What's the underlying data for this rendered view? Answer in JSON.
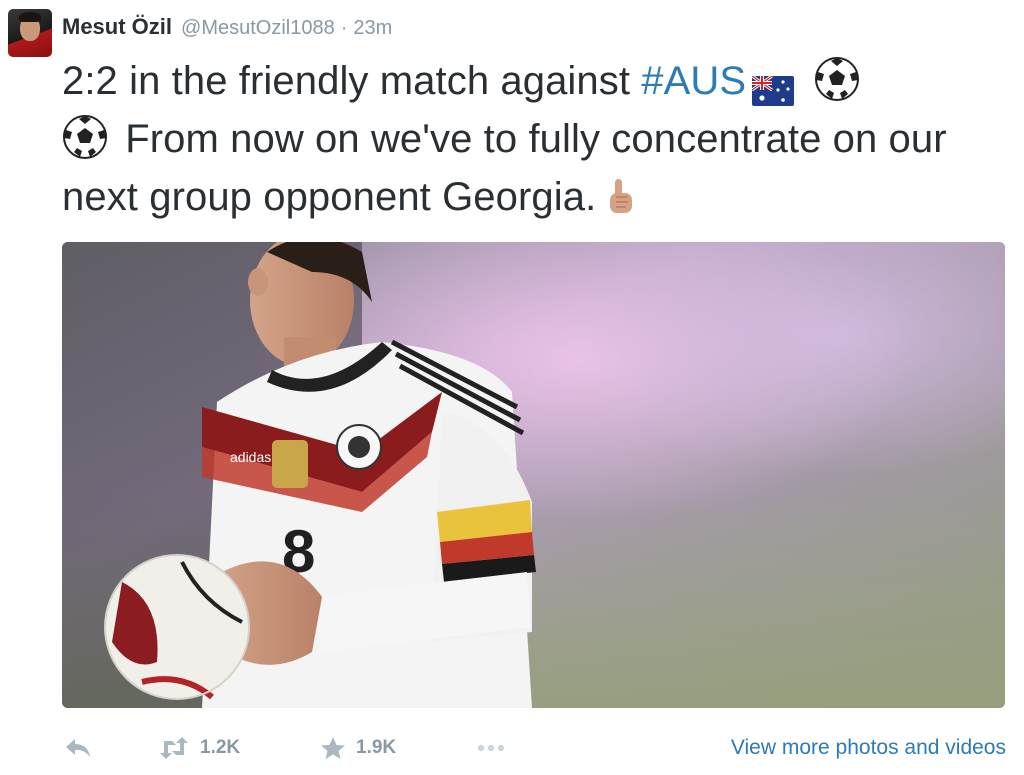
{
  "author": {
    "fullname": "Mesut Özil",
    "username": "@MesutOzil1088",
    "separator": "·",
    "timestamp": "23m"
  },
  "tweet": {
    "text_part1": "2:2 in the friendly match against ",
    "hashtag": "#AUS",
    "text_part2": "From now on we've to fully concentrate on our next group opponent Georgia.",
    "emojis": [
      "australia-flag",
      "soccer-ball",
      "soccer-ball",
      "pointing-up-hand"
    ]
  },
  "photo": {
    "description_icon": "tweet-photo",
    "jersey_number": "8",
    "brand_text": "adidas"
  },
  "actions": {
    "reply_icon": "reply-icon",
    "retweet_count": "1.2K",
    "favorite_count": "1.9K",
    "more_icon": "more-icon",
    "view_more_label": "View more photos and videos"
  },
  "colors": {
    "link": "#2b7bb9",
    "muted": "#8899a6",
    "text": "#292f33"
  }
}
